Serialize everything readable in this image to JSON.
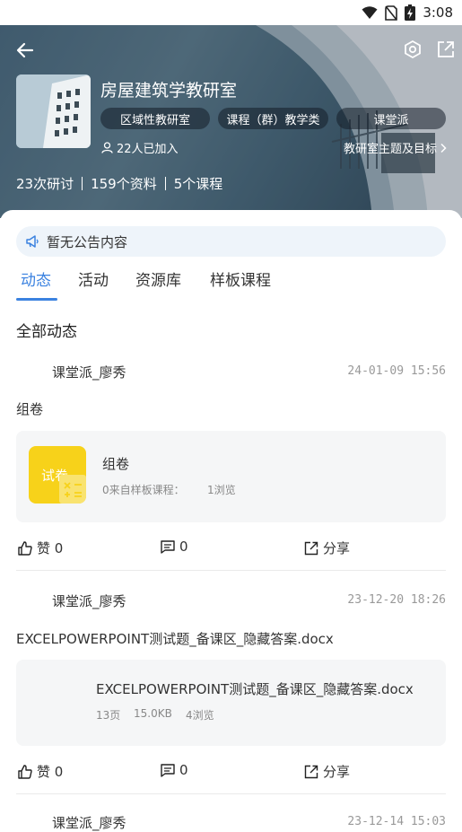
{
  "status_bar": {
    "time": "3:08"
  },
  "header": {
    "title": "房屋建筑学教研室",
    "tags": [
      "区域性教研室",
      "课程（群）教学类",
      "课堂派"
    ],
    "members": "22人已加入",
    "theme_link": "教研室主题及目标",
    "stats": [
      "23次研讨",
      "159个资料",
      "5个课程"
    ]
  },
  "notice": {
    "text": "暂无公告内容"
  },
  "tabs": [
    {
      "label": "动态",
      "active": true
    },
    {
      "label": "活动",
      "active": false
    },
    {
      "label": "资源库",
      "active": false
    },
    {
      "label": "样板课程",
      "active": false
    }
  ],
  "section_title": "全部动态",
  "posts": [
    {
      "author": "课堂派_廖秀",
      "time": "24-01-09 15:56",
      "text": "组卷",
      "card": {
        "thumb_label": "试卷",
        "title": "组卷",
        "source": "0来自样板课程：",
        "views": "1浏览"
      },
      "likes": "赞 0",
      "comments": "0",
      "share": "分享"
    },
    {
      "author": "课堂派_廖秀",
      "time": "23-12-20 18:26",
      "text": "EXCELPOWERPOINT测试题_备课区_隐藏答案.docx",
      "card": {
        "title": "EXCELPOWERPOINT测试题_备课区_隐藏答案.docx",
        "pages": "13页",
        "size": "15.0KB",
        "views": "4浏览"
      },
      "likes": "赞 0",
      "comments": "0",
      "share": "分享"
    },
    {
      "author": "课堂派_廖秀",
      "time": "23-12-14 15:03"
    }
  ],
  "colors": {
    "accent": "#3b82e0",
    "quiz_yellow": "#f7d21a",
    "card_bg": "#f5f6f7",
    "notice_bg": "#eef4fa"
  }
}
